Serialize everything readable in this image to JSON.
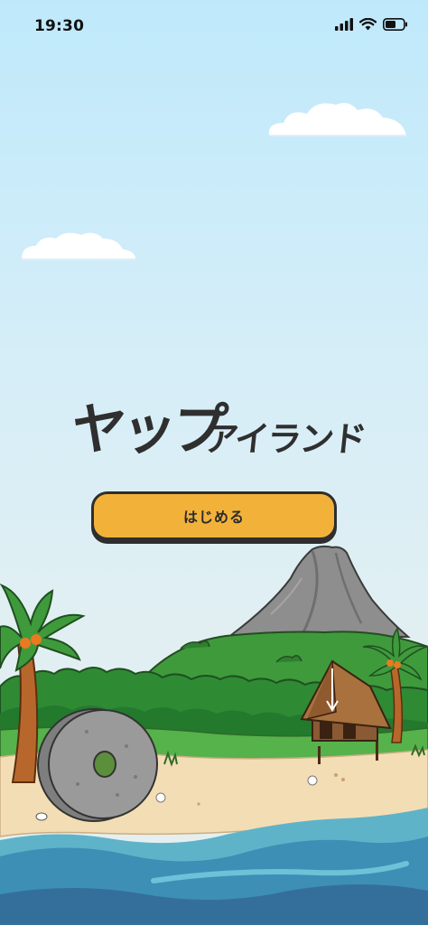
{
  "status_bar": {
    "time": "19:30"
  },
  "title": {
    "main": "ヤップ",
    "sub": "アイランド"
  },
  "start_button": {
    "label": "はじめる"
  },
  "colors": {
    "button": "#f2b23a",
    "outline": "#2e2e2e",
    "sky_top": "#bfe9fb",
    "sand": "#f3ddb5",
    "sea": "#3d8fb5",
    "grass": "#3d9a3a"
  }
}
